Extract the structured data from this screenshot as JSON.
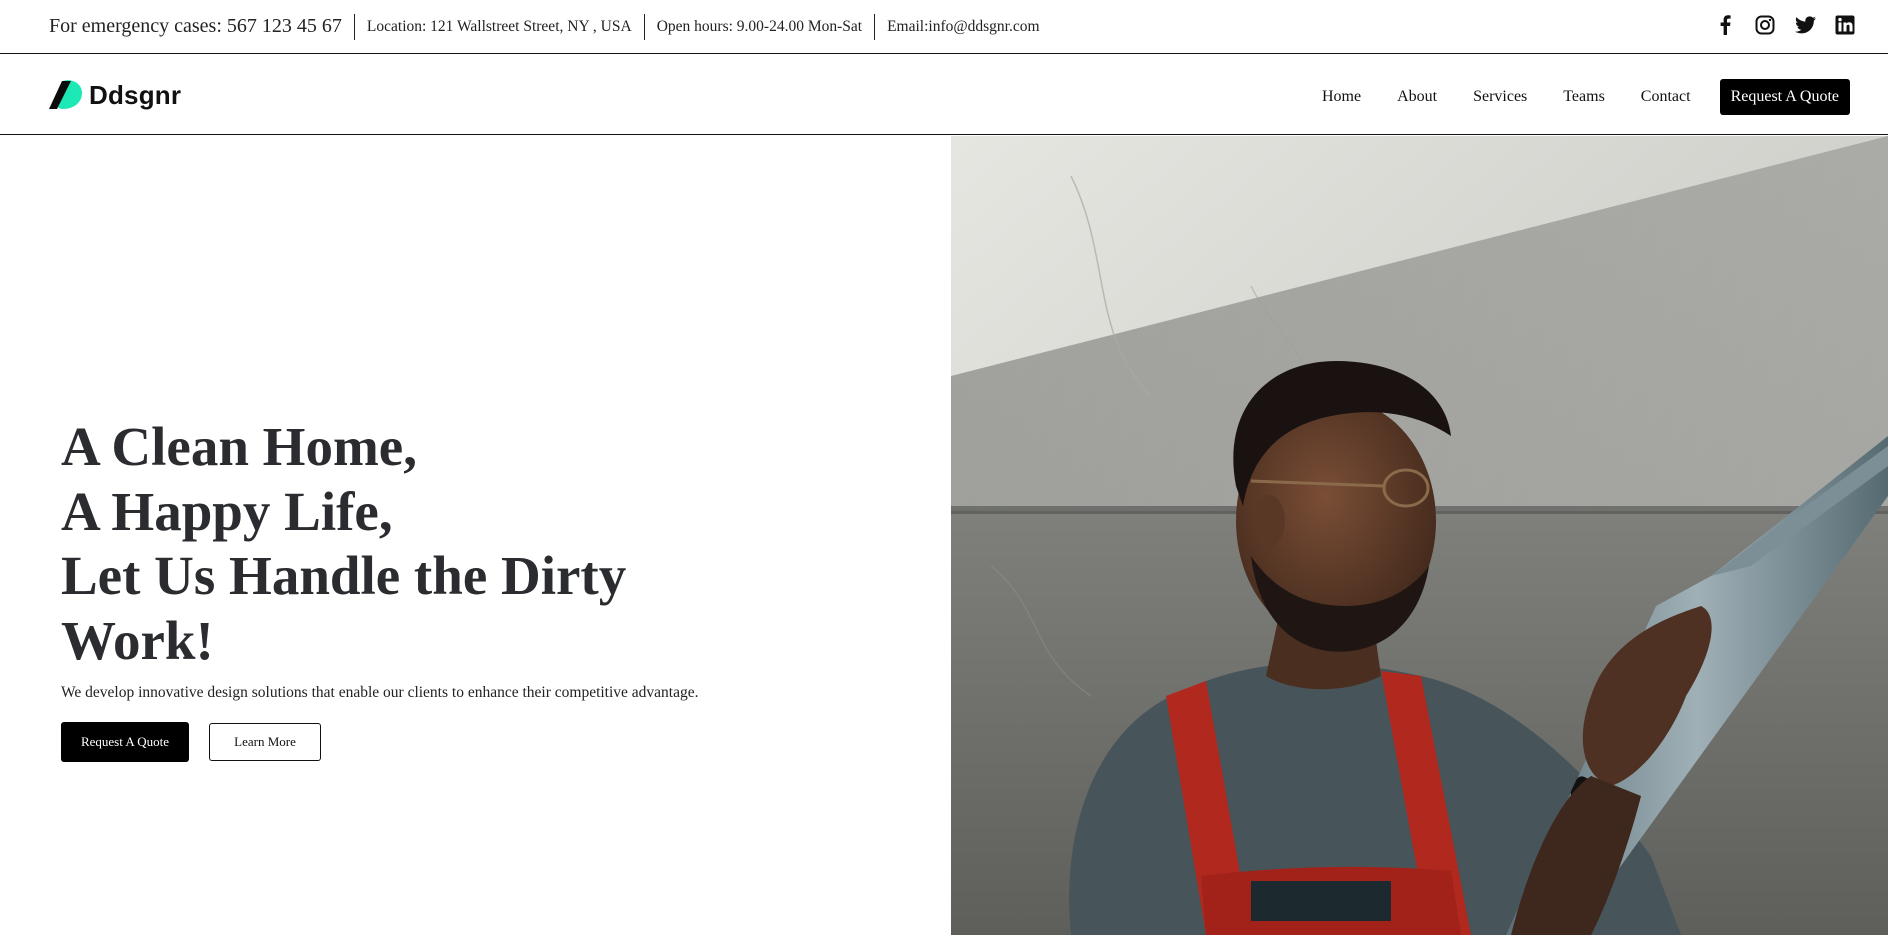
{
  "topbar": {
    "emergency": "For emergency cases: 567 123 45 67",
    "location": "Location: 121 Wallstreet Street, NY , USA",
    "hours": "Open hours: 9.00-24.00 Mon-Sat",
    "email": "Email:info@ddsgnr.com",
    "social": [
      "facebook-icon",
      "instagram-icon",
      "twitter-icon",
      "linkedin-icon"
    ]
  },
  "brand": {
    "name": "Ddsgnr",
    "accent": "#1de9b6"
  },
  "nav": {
    "items": [
      "Home",
      "About",
      "Services",
      "Teams",
      "Contact"
    ],
    "cta": "Request A Quote"
  },
  "hero": {
    "headline": [
      "A Clean Home,",
      "A Happy Life,",
      "Let Us Handle the Dirty",
      "Work!"
    ],
    "subtext": "We develop innovative design solutions that enable our clients to enhance their competitive advantage.",
    "primary_button": "Request A Quote",
    "secondary_button": "Learn More"
  }
}
